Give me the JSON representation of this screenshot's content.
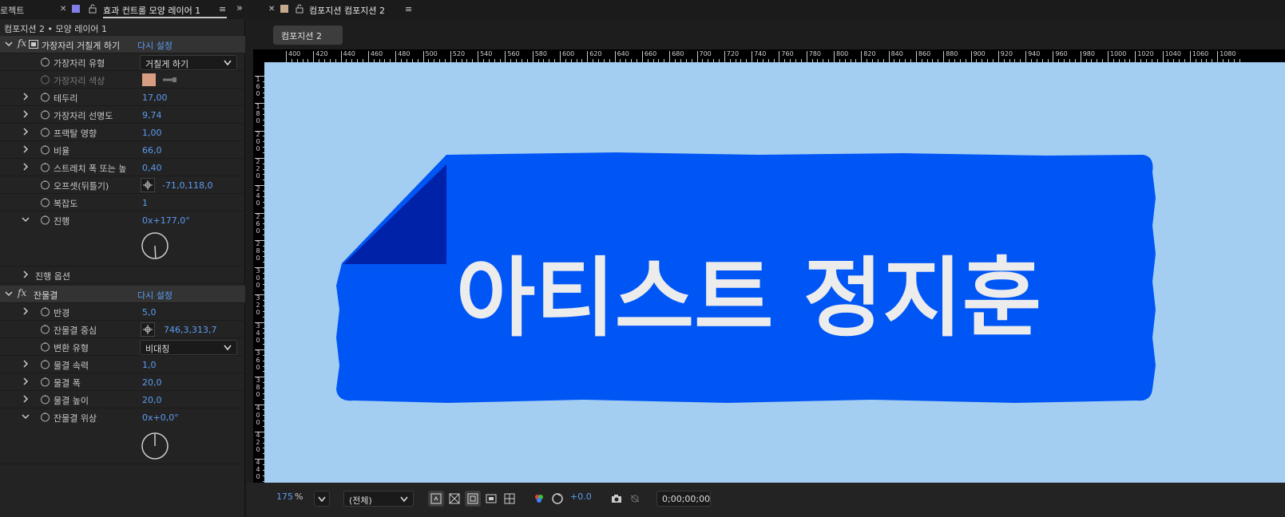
{
  "left_panel": {
    "project_tab": "로젝트",
    "effects_tab": "효과 컨트롤 모양 레이어 1",
    "layer_path": "컴포지션 2 • 모양 레이어 1",
    "rough_edges": {
      "name": "가장자리 거칠게 하기",
      "reset": "다시 설정",
      "edge_type_label": "가장자리 유형",
      "edge_type_value": "거칠게 하기",
      "edge_color_label": "가장자리 색상",
      "edge_color": "#d79c82",
      "border_label": "테두리",
      "border_value": "17,00",
      "sharpness_label": "가장자리 선명도",
      "sharpness_value": "9,74",
      "fractal_label": "프랙탈 영향",
      "fractal_value": "1,00",
      "scale_label": "비율",
      "scale_value": "66,0",
      "stretch_label": "스트레치 폭 또는 높",
      "stretch_value": "0,40",
      "offset_label": "오프셋(뒤틀기)",
      "offset_value": "-71,0,118,0",
      "complexity_label": "복잡도",
      "complexity_value": "1",
      "evolution_label": "진행",
      "evolution_value": "0x+177,0°",
      "evolution_angle_deg": 177,
      "evolution_options_label": "진행 옵션"
    },
    "ripple": {
      "name": "잔물결",
      "reset": "다시 설정",
      "radius_label": "반경",
      "radius_value": "5,0",
      "center_label": "잔물결 중심",
      "center_value": "746,3,313,7",
      "conversion_label": "변환 유형",
      "conversion_value": "비대칭",
      "speed_label": "물결 속력",
      "speed_value": "1,0",
      "width_label": "물결 폭",
      "width_value": "20,0",
      "height_label": "물결 높이",
      "height_value": "20,0",
      "phase_label": "잔물결 위상",
      "phase_value": "0x+0,0°",
      "phase_angle_deg": 0
    }
  },
  "composition": {
    "tab_title": "컴포지션 컴포지션 2",
    "comp_button": "컴포지션 2",
    "ruler_labels": [
      "400",
      "420",
      "440",
      "460",
      "480",
      "500",
      "520",
      "540",
      "560",
      "580",
      "600",
      "620",
      "640",
      "660",
      "680",
      "700",
      "720",
      "740",
      "760",
      "780",
      "800",
      "820",
      "840",
      "860",
      "880",
      "900",
      "920",
      "940",
      "960",
      "980",
      "1000",
      "1020",
      "1040",
      "1060",
      "1080"
    ],
    "ruler_left_labels": [
      "160",
      "180",
      "200",
      "220",
      "240",
      "260",
      "280",
      "300",
      "320",
      "340",
      "360",
      "380",
      "400",
      "420",
      "440"
    ],
    "artwork_text": "아티스트 정지훈",
    "background_color": "#a3cef2",
    "banner_color": "#0055f5",
    "fold_color": "#0022a8",
    "text_color": "#ececec"
  },
  "toolbar": {
    "zoom": "175",
    "zoom_unit": "%",
    "resolution": "(전체)",
    "exposure": "+0.0",
    "timecode": "0;00;00;00"
  }
}
